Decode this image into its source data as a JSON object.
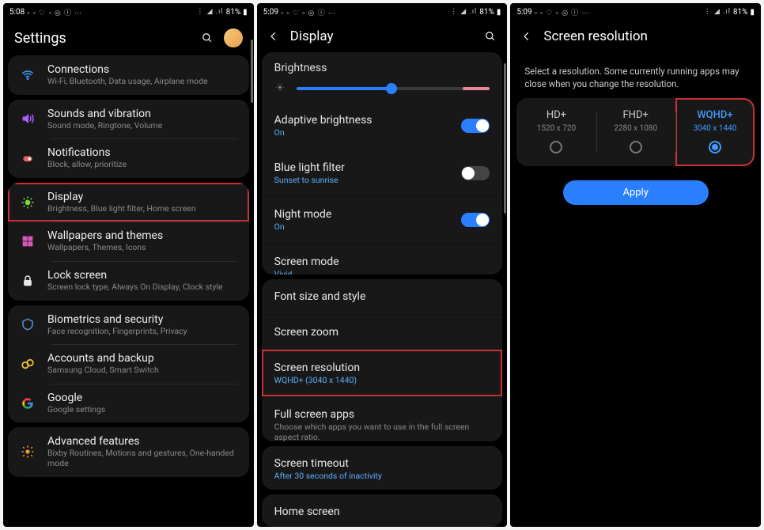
{
  "status": {
    "time1": "5:08",
    "time2": "5:09",
    "time3": "5:09",
    "battery": "81%",
    "icons_left": "▫ ▫ ♡ ▫ ◎ ⓘ ⋯",
    "icons_right": "⋮ ◢ .ıl"
  },
  "screen1": {
    "title": "Settings",
    "items": [
      {
        "icon": "wifi",
        "color": "#3d9cff",
        "title": "Connections",
        "sub": "Wi-Fi, Bluetooth, Data usage, Airplane mode"
      },
      {
        "icon": "sound",
        "color": "#b05cff",
        "title": "Sounds and vibration",
        "sub": "Sound mode, Ringtone, Volume"
      },
      {
        "icon": "notif",
        "color": "#e86060",
        "title": "Notifications",
        "sub": "Block, allow, prioritize"
      },
      {
        "icon": "display",
        "color": "#7fd83f",
        "title": "Display",
        "sub": "Brightness, Blue light filter, Home screen",
        "highlight": true
      },
      {
        "icon": "wallpaper",
        "color": "#d858b8",
        "title": "Wallpapers and themes",
        "sub": "Wallpapers, Themes, Icons"
      },
      {
        "icon": "lock",
        "color": "#e8e8e8",
        "title": "Lock screen",
        "sub": "Screen lock type, Always On Display, Clock style"
      },
      {
        "icon": "biometrics",
        "color": "#5a8fd8",
        "title": "Biometrics and security",
        "sub": "Face recognition, Fingerprints, Privacy"
      },
      {
        "icon": "accounts",
        "color": "#e8b838",
        "title": "Accounts and backup",
        "sub": "Samsung Cloud, Smart Switch"
      },
      {
        "icon": "google",
        "color": "#4285f4",
        "title": "Google",
        "sub": "Google settings"
      },
      {
        "icon": "advanced",
        "color": "#e8a030",
        "title": "Advanced features",
        "sub": "Bixby Routines, Motions and gestures, One-handed mode"
      }
    ]
  },
  "screen2": {
    "title": "Display",
    "brightness_label": "Brightness",
    "brightness_pct": 49,
    "rows_top": [
      {
        "title": "Adaptive brightness",
        "sub": "On",
        "subAccent": true,
        "toggle": true
      },
      {
        "title": "Blue light filter",
        "sub": "Sunset to sunrise",
        "subAccent": true,
        "toggle": false
      },
      {
        "title": "Night mode",
        "sub": "On",
        "subAccent": true,
        "toggle": true
      },
      {
        "title": "Screen mode",
        "sub": "Vivid",
        "subAccent": true
      }
    ],
    "rows_mid": [
      {
        "title": "Font size and style"
      },
      {
        "title": "Screen zoom"
      },
      {
        "title": "Screen resolution",
        "sub": "WQHD+ (3040 x 1440)",
        "subAccent": true,
        "highlight": true
      },
      {
        "title": "Full screen apps",
        "sub": "Choose which apps you want to use in the full screen aspect ratio."
      }
    ],
    "rows_bot": [
      {
        "title": "Screen timeout",
        "sub": "After 30 seconds of inactivity",
        "subAccent": true
      }
    ],
    "row_last": "Home screen"
  },
  "screen3": {
    "title": "Screen resolution",
    "desc": "Select a resolution. Some currently running apps may close when you change the resolution.",
    "options": [
      {
        "name": "HD+",
        "dim": "1520 x 720",
        "selected": false
      },
      {
        "name": "FHD+",
        "dim": "2280 x 1080",
        "selected": false
      },
      {
        "name": "WQHD+",
        "dim": "3040 x 1440",
        "selected": true,
        "highlight": true
      }
    ],
    "apply": "Apply"
  }
}
